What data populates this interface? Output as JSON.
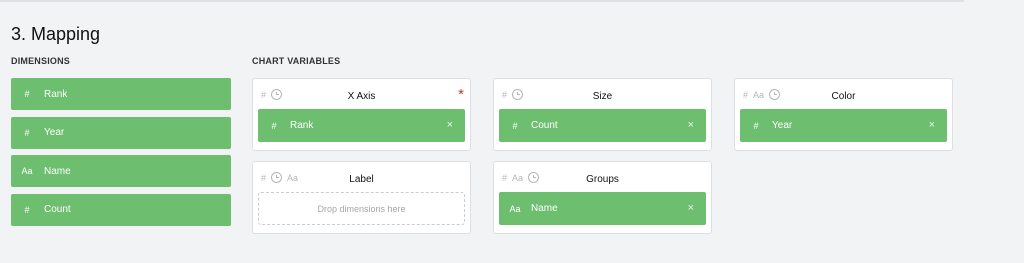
{
  "section_title": "3. Mapping",
  "dimensions_label": "DIMENSIONS",
  "chart_variables_label": "CHART VARIABLES",
  "dimensions": [
    {
      "type": "#",
      "name": "Rank"
    },
    {
      "type": "#",
      "name": "Year"
    },
    {
      "type": "Aa",
      "name": "Name"
    },
    {
      "type": "#",
      "name": "Count"
    }
  ],
  "variables": {
    "x_axis": {
      "title": "X Axis",
      "required_mark": "*",
      "icons": [
        "#"
      ],
      "mapped": {
        "type": "#",
        "name": "Rank"
      },
      "remove": "×"
    },
    "size": {
      "title": "Size",
      "icons": [
        "#"
      ],
      "mapped": {
        "type": "#",
        "name": "Count"
      },
      "remove": "×"
    },
    "color": {
      "title": "Color",
      "icons": [
        "#",
        "Aa"
      ],
      "mapped": {
        "type": "#",
        "name": "Year"
      },
      "remove": "×"
    },
    "label": {
      "title": "Label",
      "icons": [
        "#",
        "Aa"
      ],
      "dropzone": "Drop dimensions here"
    },
    "groups": {
      "title": "Groups",
      "icons": [
        "#",
        "Aa"
      ],
      "mapped": {
        "type": "Aa",
        "name": "Name"
      },
      "remove": "×"
    }
  },
  "colors": {
    "accent_green": "#6dbe6f",
    "required_red": "#c0392b"
  }
}
